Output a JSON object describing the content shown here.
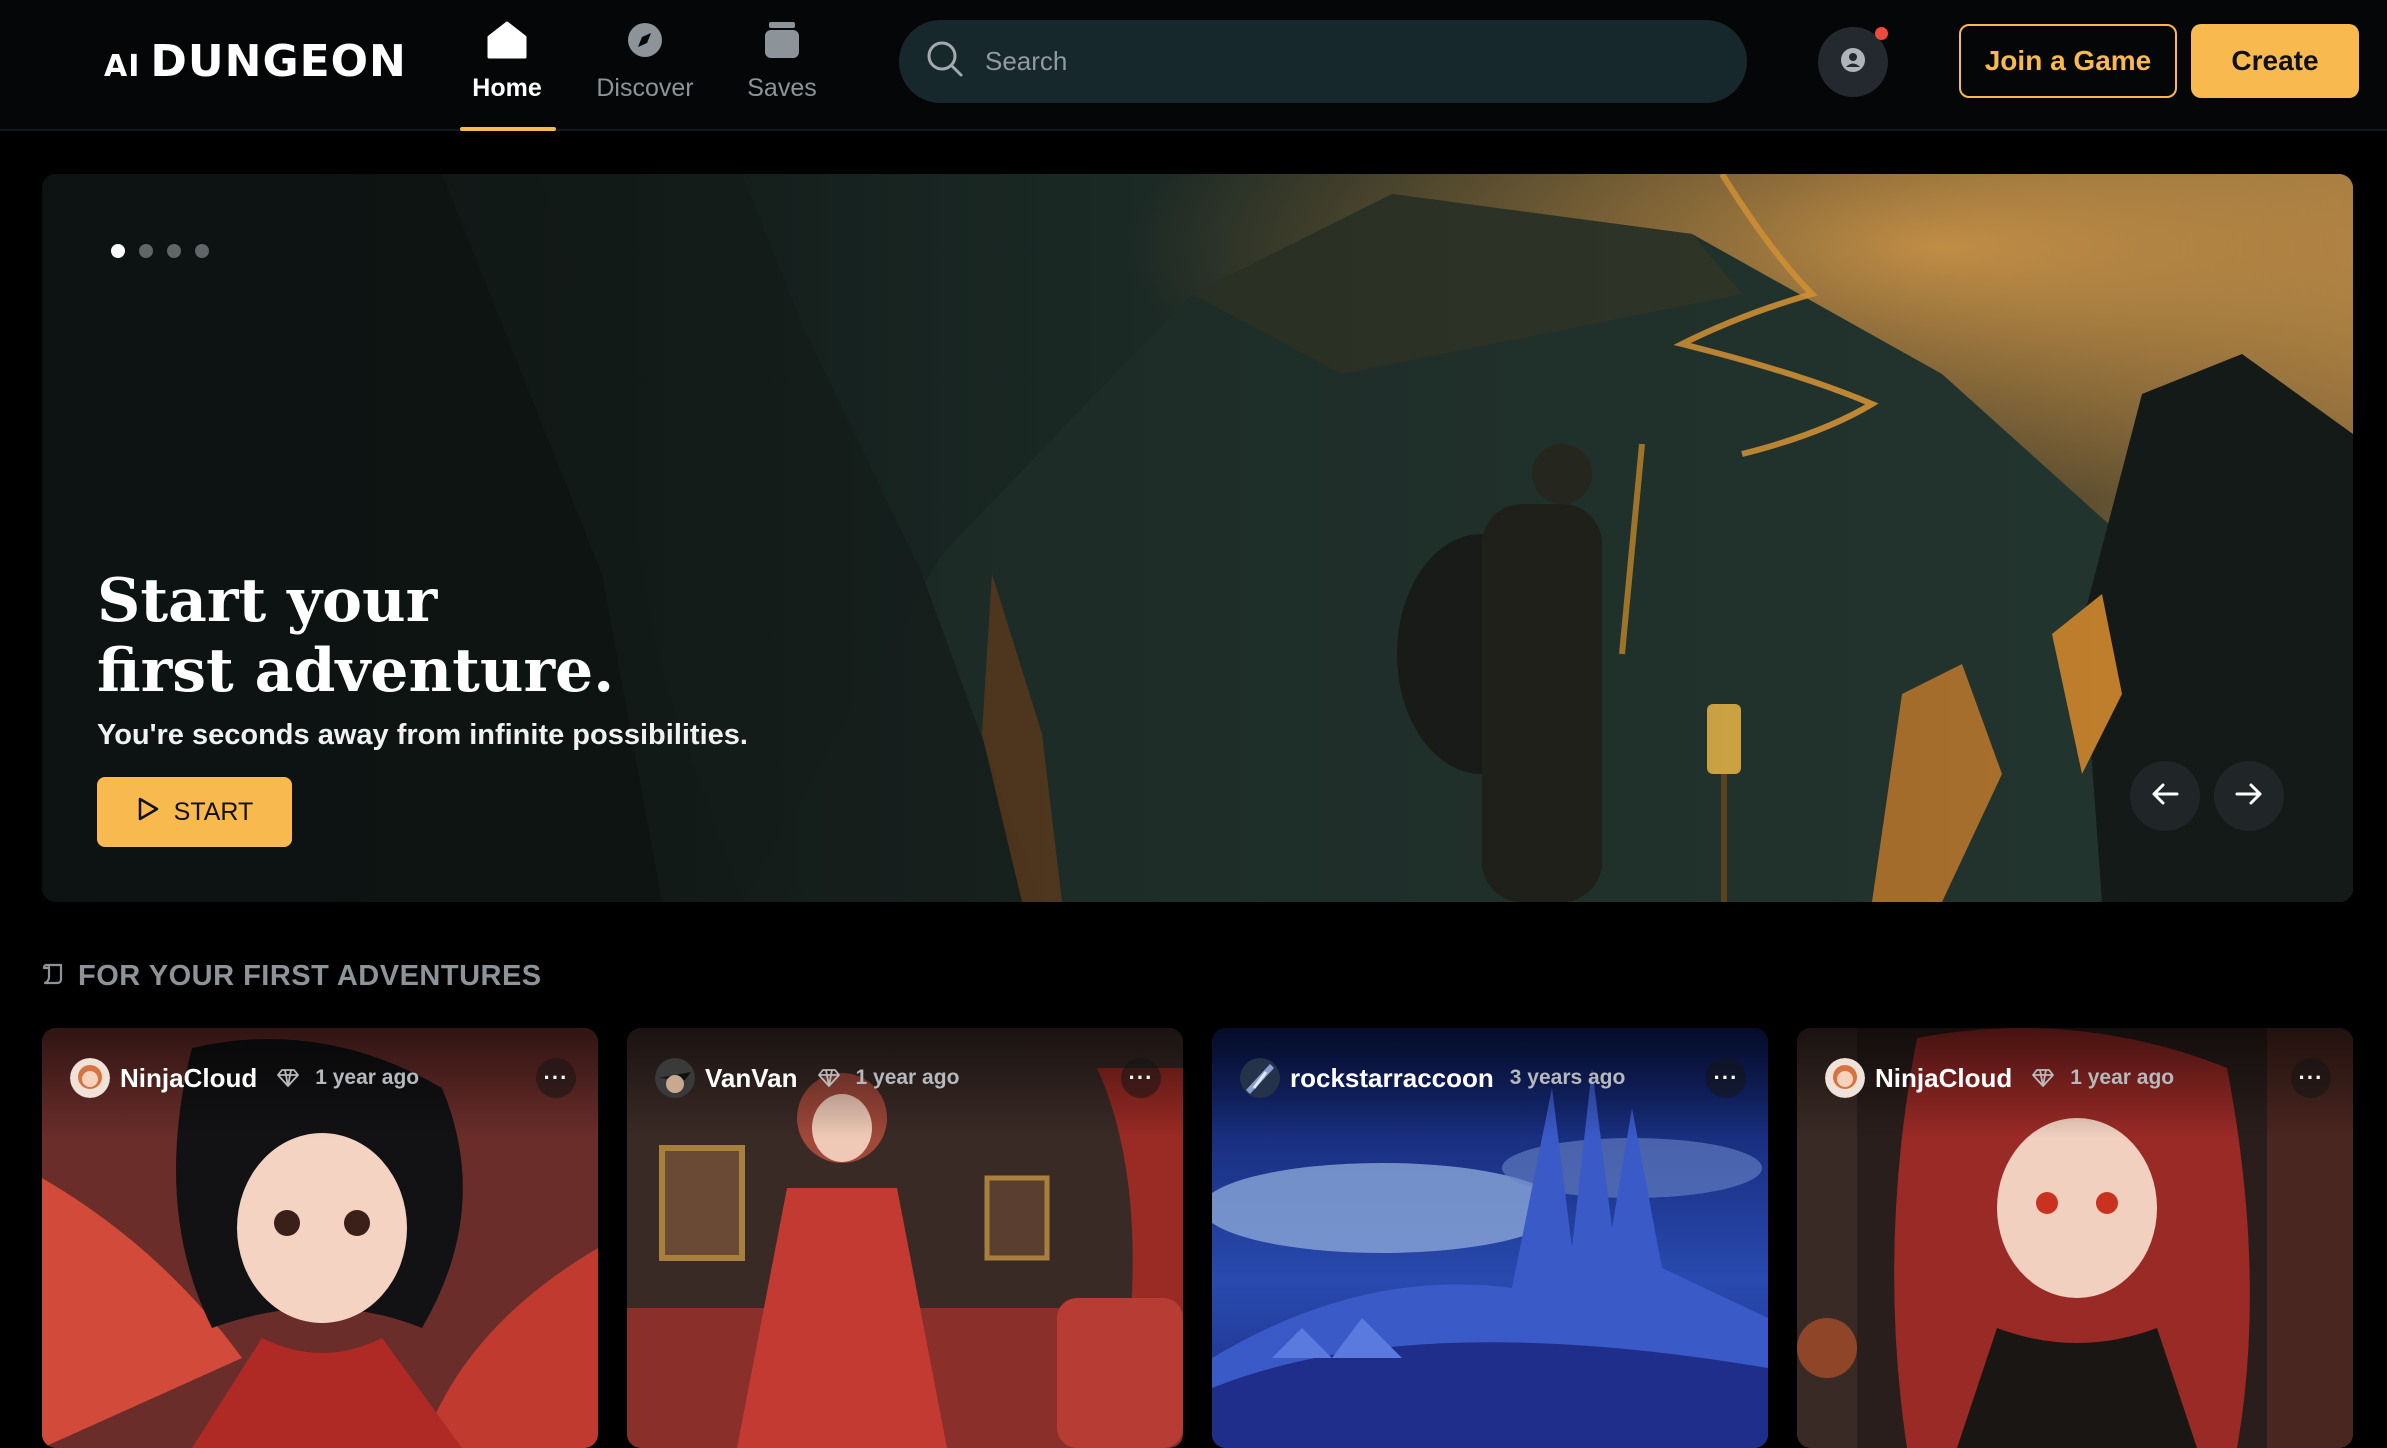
{
  "header": {
    "logo_ai": "AI",
    "logo_main": "DUNGEON",
    "nav": [
      {
        "label": "Home",
        "icon": "home-icon",
        "active": true
      },
      {
        "label": "Discover",
        "icon": "compass-icon",
        "active": false
      },
      {
        "label": "Saves",
        "icon": "jar-icon",
        "active": false
      }
    ],
    "search_placeholder": "Search",
    "join_label": "Join a Game",
    "create_label": "Create"
  },
  "hero": {
    "title_line1": "Start your",
    "title_line2": "first adventure.",
    "subtitle": "You're seconds away from infinite possibilities.",
    "start_label": "START",
    "slide_count": 4,
    "active_slide": 1
  },
  "section": {
    "title": "FOR YOUR FIRST ADVENTURES",
    "icon": "scroll-icon"
  },
  "cards": [
    {
      "user": "NinjaCloud",
      "time": "1 year ago",
      "has_badge": true
    },
    {
      "user": "VanVan",
      "time": "1 year ago",
      "has_badge": true
    },
    {
      "user": "rockstarraccoon",
      "time": "3 years ago",
      "has_badge": false
    },
    {
      "user": "NinjaCloud",
      "time": "1 year ago",
      "has_badge": true
    }
  ],
  "colors": {
    "accent": "#f8b94f",
    "background": "#000000",
    "header": "#040608",
    "search_bg": "#17282c",
    "notification": "#ec4b3d",
    "muted_text": "#8d9499"
  }
}
